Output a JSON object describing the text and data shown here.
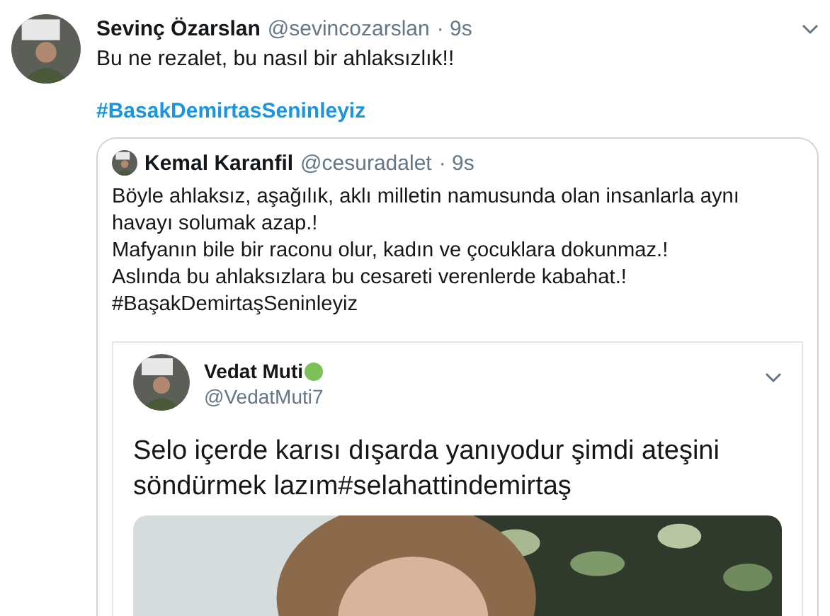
{
  "tweet": {
    "name": "Sevinç Özarslan",
    "handle": "@sevincozarslan",
    "time": "· 9s",
    "text": "Bu ne rezalet, bu nasıl bir ahlaksızlık!!",
    "hashtag": "#BasakDemirtasSeninleyiz",
    "quote": {
      "name": "Kemal Karanfil",
      "handle": "@cesuradalet",
      "time": "· 9s",
      "lines": [
        "Böyle ahlaksız, aşağılık, aklı milletin namusunda olan insanlarla aynı havayı solumak azap.!",
        "Mafyanın bile bir raconu olur, kadın ve çocuklara dokunmaz.!",
        "Aslında bu ahlaksızlara bu cesareti verenlerde kabahat.!",
        "#BaşakDemirtaşSeninleyiz"
      ],
      "screenshot": {
        "name": "Vedat Muti",
        "handle": "@VedatMuti7",
        "text": "Selo içerde karısı dışarda yanıyodur şimdi ateşini söndürmek lazım#selahattindemirtaş"
      }
    }
  }
}
